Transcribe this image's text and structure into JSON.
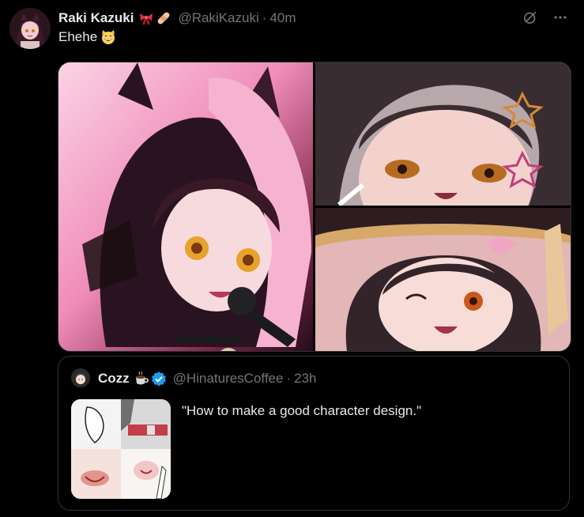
{
  "tweet": {
    "author": {
      "display_name": "Raki Kazuki",
      "name_emojis": [
        "ribbon-emoji",
        "bandage-emoji"
      ],
      "handle": "@RakiKazuki",
      "separator": "·",
      "time": "40m"
    },
    "text": "Ehehe",
    "text_emoji": "grinning-cat-emoji",
    "top_icons": [
      "grok-icon",
      "more-icon"
    ],
    "media": [
      {
        "alt": "anime girl with cat ears singing into microphone"
      },
      {
        "alt": "anime girl with star hair clips, close-up"
      },
      {
        "alt": "anime girl winking with bow"
      }
    ]
  },
  "quote": {
    "author": {
      "display_name": "Cozz",
      "name_emoji": "coffee-emoji",
      "verified_icon": "verified-badge-icon",
      "handle": "@HinaturesCoffee",
      "separator": "·",
      "time": "23h"
    },
    "text": "\"How to make a good character design.\""
  },
  "colors": {
    "background": "#000000",
    "text_primary": "#e7e9ea",
    "text_secondary": "#71767b",
    "border": "#2f3336",
    "verified": "#1d9bf0"
  }
}
